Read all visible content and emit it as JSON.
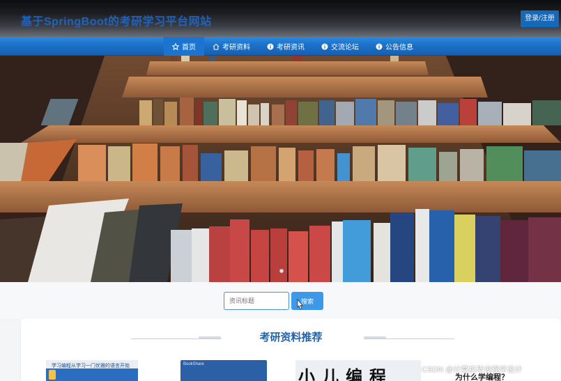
{
  "header": {
    "site_title": "基于SpringBoot的考研学习平台网站",
    "login_label": "登录/注册"
  },
  "nav": {
    "items": [
      {
        "label": "首页",
        "icon": "star-icon",
        "active": true
      },
      {
        "label": "考研资料",
        "icon": "home-icon",
        "active": false
      },
      {
        "label": "考研资讯",
        "icon": "info-icon",
        "active": false
      },
      {
        "label": "交流论坛",
        "icon": "info-icon",
        "active": false
      },
      {
        "label": "公告信息",
        "icon": "info-icon",
        "active": false
      }
    ]
  },
  "banner": {
    "image": "bookshelf-photo",
    "slide_count": 1
  },
  "search": {
    "placeholder": "资讯标题",
    "button_label": "搜索"
  },
  "recommend": {
    "title": "考研资料推荐",
    "thumb1_text": "学习编程从学习一门优雅的语言开始",
    "thumb2_text": "BookShare",
    "thumb3_text": "小儿编程",
    "side_text": "为什么学编程？"
  },
  "watermark": "CSDN @计算机毕设程序设计",
  "colors": {
    "brand": "#1e5fb8",
    "nav": "#1a6fc6",
    "button": "#3d99e8",
    "section_title": "#1f64ad"
  }
}
